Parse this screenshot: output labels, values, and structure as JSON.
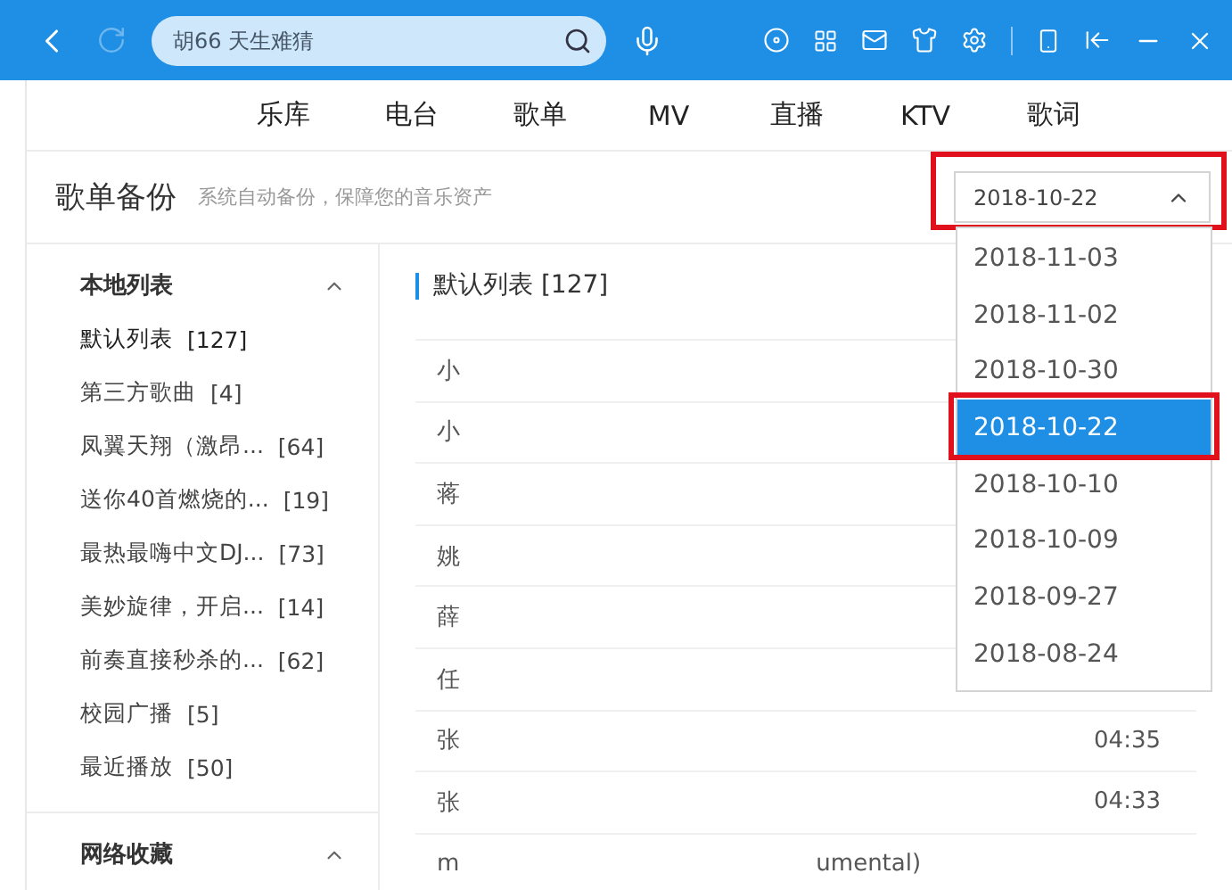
{
  "toolbar": {
    "search": {
      "placeholder": "胡66 天生难猜"
    }
  },
  "tabs": [
    {
      "label": "乐库",
      "selected": false
    },
    {
      "label": "电台",
      "selected": false
    },
    {
      "label": "歌单",
      "selected": false
    },
    {
      "label": "MV",
      "selected": false
    },
    {
      "label": "直播",
      "selected": false
    },
    {
      "label": "KTV",
      "selected": false
    },
    {
      "label": "歌词",
      "selected": false
    }
  ],
  "page": {
    "title": "歌单备份",
    "subtitle": "系统自动备份，保障您的音乐资产"
  },
  "date_select": {
    "value": "2018-10-22",
    "expanded": true,
    "highlighted": true,
    "options": [
      {
        "label": "2018-11-03",
        "selected": false,
        "highlighted": false
      },
      {
        "label": "2018-11-02",
        "selected": false,
        "highlighted": false
      },
      {
        "label": "2018-10-30",
        "selected": false,
        "highlighted": false
      },
      {
        "label": "2018-10-22",
        "selected": true,
        "highlighted": true
      },
      {
        "label": "2018-10-10",
        "selected": false,
        "highlighted": false
      },
      {
        "label": "2018-10-09",
        "selected": false,
        "highlighted": false
      },
      {
        "label": "2018-09-27",
        "selected": false,
        "highlighted": false
      },
      {
        "label": "2018-08-24",
        "selected": false,
        "highlighted": false
      }
    ]
  },
  "sidebar": {
    "groups": [
      {
        "title": "本地列表",
        "expanded": true,
        "items": [
          {
            "name": "默认列表",
            "count": "[127]",
            "selected": true
          },
          {
            "name": "第三方歌曲",
            "count": "[4]",
            "selected": false
          },
          {
            "name": "凤翼天翔（激昂...",
            "count": "[64]",
            "selected": false
          },
          {
            "name": "送你40首燃烧的...",
            "count": "[19]",
            "selected": false
          },
          {
            "name": "最热最嗨中文DJ...",
            "count": "[73]",
            "selected": false
          },
          {
            "name": "美妙旋律，开启...",
            "count": "[14]",
            "selected": false
          },
          {
            "name": "前奏直接秒杀的...",
            "count": "[62]",
            "selected": false
          },
          {
            "name": "校园广播",
            "count": "[5]",
            "selected": false
          },
          {
            "name": "最近播放",
            "count": "[50]",
            "selected": false
          }
        ]
      },
      {
        "title": "网络收藏",
        "expanded": true
      }
    ]
  },
  "songs": {
    "title": "默认列表 [127]",
    "rows": [
      {
        "name": "小"
      },
      {
        "name": "小"
      },
      {
        "name": "蒋"
      },
      {
        "name": "姚"
      },
      {
        "name": "薛"
      },
      {
        "name": "任"
      },
      {
        "name": "张",
        "duration": "04:35"
      },
      {
        "name": "张",
        "duration": "04:33"
      },
      {
        "name": "m",
        "extra": "umental)"
      }
    ]
  }
}
